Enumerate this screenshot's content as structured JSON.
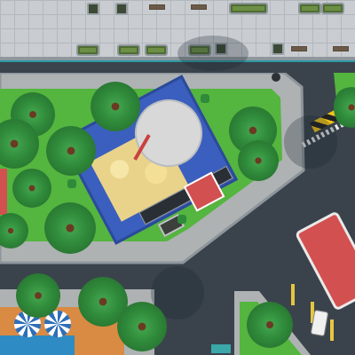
{
  "scene": {
    "type": "top-down city game view",
    "colors": {
      "grass": "#54b53f",
      "asphalt": "#3a434c",
      "sidewalk": "#c9cdd1",
      "plaza": "#aeb2b3",
      "roof_blue": "#3b5fbe",
      "awning": "#d8d8d8",
      "orange_tile": "#d98a43",
      "water": "#2f8bc4",
      "red_roof": "#d35050"
    },
    "objects": [
      "palm-trees",
      "blue-roof-building",
      "white-umbrella",
      "red-kiosk",
      "red-vehicle",
      "parked-car",
      "pool",
      "beach-umbrellas",
      "hazard-stripes",
      "street-planters"
    ]
  }
}
